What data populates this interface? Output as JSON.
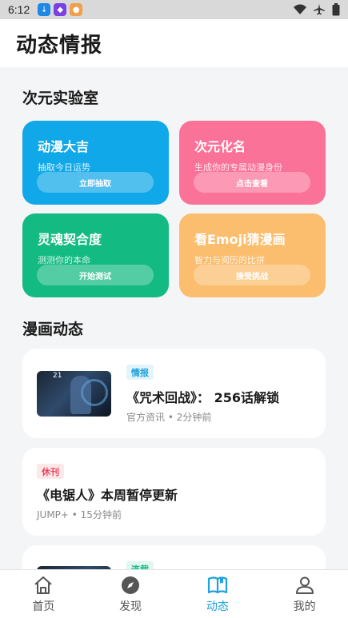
{
  "status_bar": {
    "time": "6:12",
    "icons": [
      "download-icon",
      "app-icon",
      "app2-icon",
      "wifi-icon",
      "airplane-icon",
      "battery-icon"
    ]
  },
  "header": {
    "title": "动态情报"
  },
  "lab": {
    "title": "次元实验室",
    "cards": [
      {
        "title": "动漫大吉",
        "subtitle": "抽取今日运势",
        "button": "立即抽取",
        "color": "#10a8e9"
      },
      {
        "title": "次元化名",
        "subtitle": "生成你的专属动漫身份",
        "button": "点击查看",
        "color": "#fb7299"
      },
      {
        "title": "灵魂契合度",
        "subtitle": "测测你的本命",
        "button": "开始测试",
        "color": "#13ba82"
      },
      {
        "title": "看Emoji猜漫画",
        "subtitle": "智力与阅历的比拼",
        "button": "接受挑战",
        "color": "#fbbd6e"
      }
    ]
  },
  "news": {
    "title": "漫画动态",
    "items": [
      {
        "tag": "情报",
        "title": "《咒术回战》： 256话解锁",
        "meta": "官方资讯 • 2分钟前",
        "thumb_text": "21",
        "tag_color": "#1ea1dc",
        "tag_bg": "#e3f4fc"
      },
      {
        "tag": "休刊",
        "title": "《电锯人》本周暂停更新",
        "meta": "JUMP+ • 15分钟前",
        "tag_color": "#e8455a",
        "tag_bg": "#fde8ea"
      },
      {
        "tag": "连载",
        "tag_color": "#13ba82",
        "tag_bg": "#e2f7ef"
      }
    ]
  },
  "tabs": [
    {
      "label": "首页",
      "icon": "home-icon",
      "active": false
    },
    {
      "label": "发现",
      "icon": "compass-icon",
      "active": false
    },
    {
      "label": "动态",
      "icon": "book-icon",
      "active": true
    },
    {
      "label": "我的",
      "icon": "user-icon",
      "active": false
    }
  ]
}
